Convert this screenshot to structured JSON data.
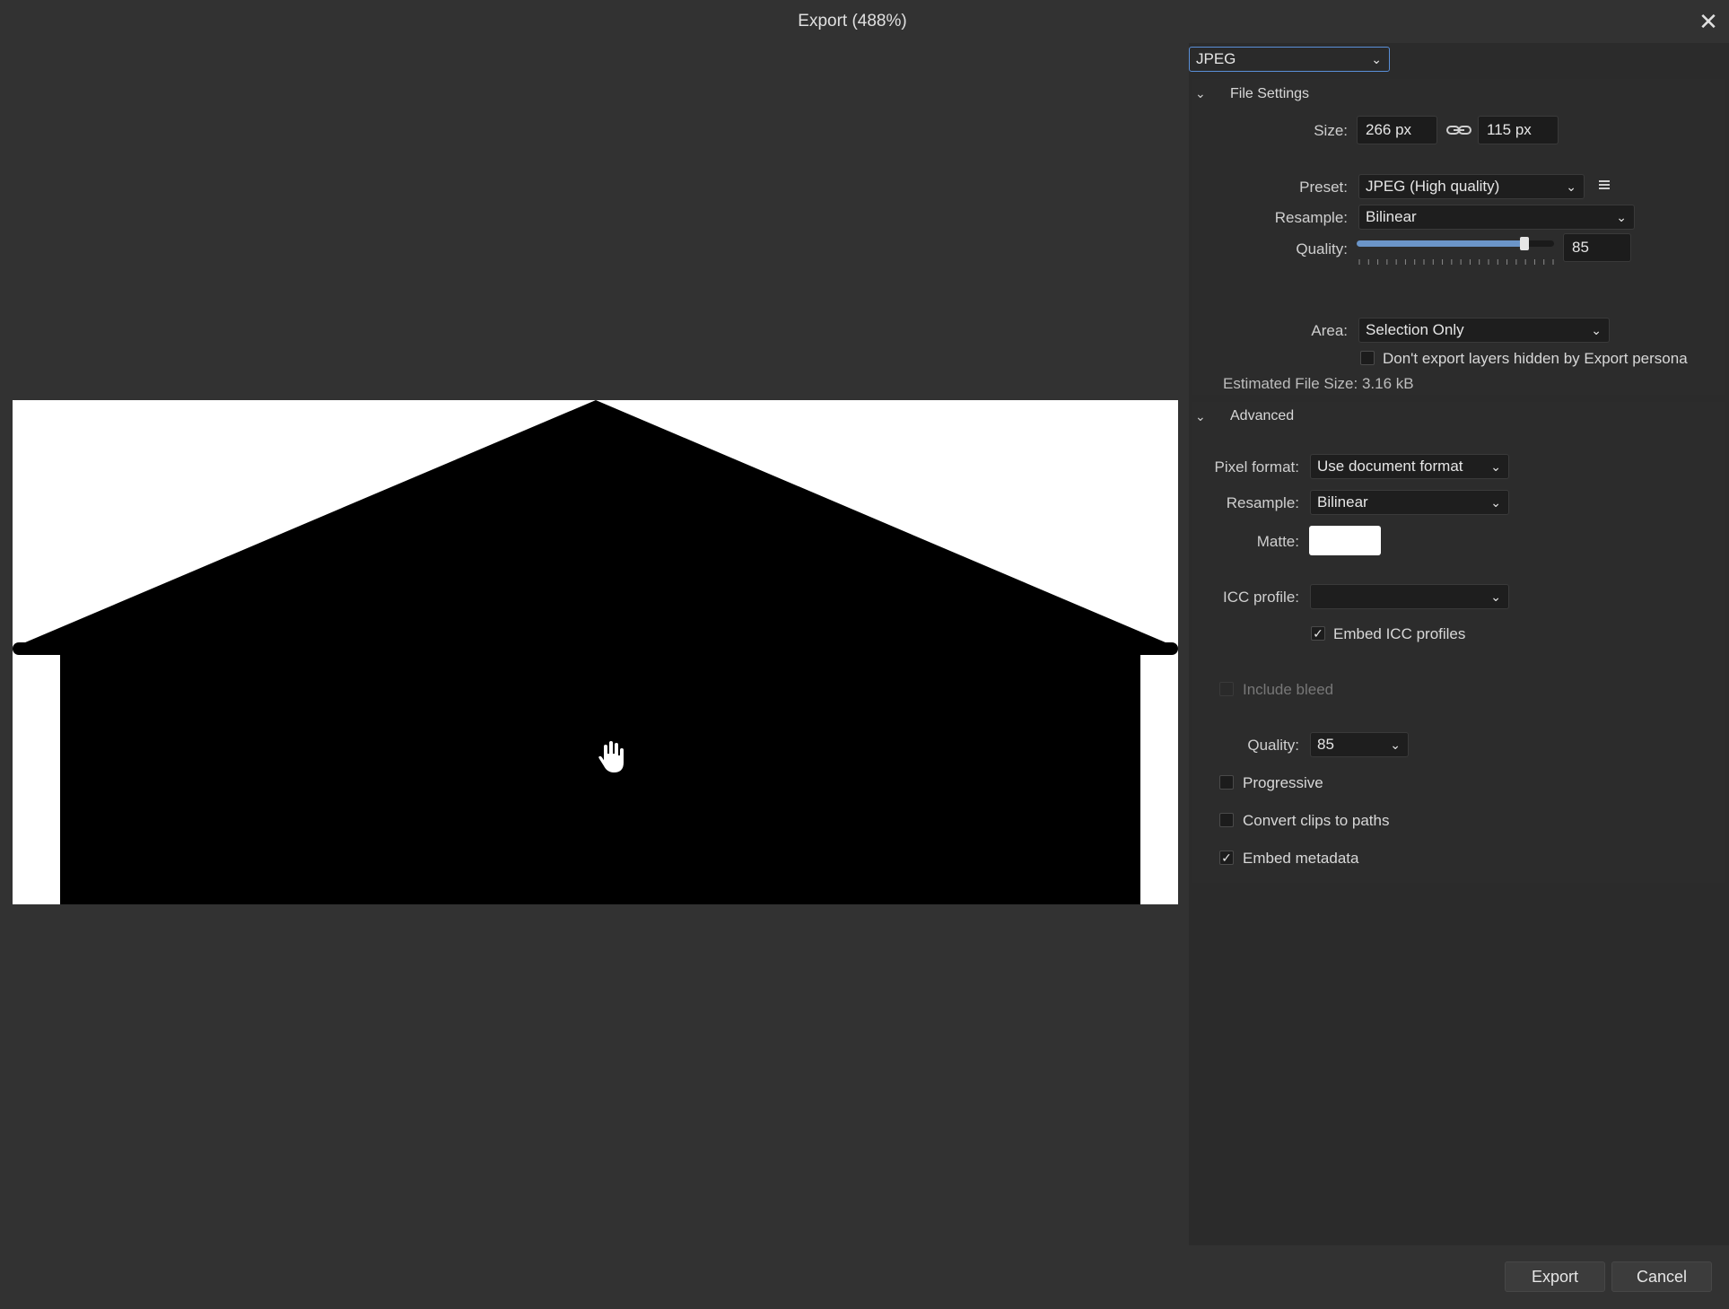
{
  "window": {
    "title": "Export (488%)",
    "close_glyph": "✕"
  },
  "format": {
    "selected": "JPEG"
  },
  "file_settings": {
    "header": "File Settings",
    "size_label": "Size:",
    "width": "266 px",
    "height": "115 px",
    "preset_label": "Preset:",
    "preset_value": "JPEG (High quality)",
    "resample_label": "Resample:",
    "resample_value": "Bilinear",
    "quality_label": "Quality:",
    "quality_value": "85",
    "quality_fraction": 0.85,
    "area_label": "Area:",
    "area_value": "Selection Only",
    "hidden_layers_label": "Don't export layers hidden by Export persona",
    "hidden_layers_checked": false,
    "estimated_size": "Estimated File Size: 3.16 kB"
  },
  "advanced": {
    "header": "Advanced",
    "pixel_format_label": "Pixel format:",
    "pixel_format_value": "Use document format",
    "resample_label": "Resample:",
    "resample_value": "Bilinear",
    "matte_label": "Matte:",
    "matte_color": "#ffffff",
    "icc_label": "ICC profile:",
    "icc_value": "",
    "embed_icc_label": "Embed ICC profiles",
    "embed_icc_checked": true,
    "include_bleed_label": "Include bleed",
    "include_bleed_checked": false,
    "quality_label": "Quality:",
    "quality_value": "85",
    "progressive_label": "Progressive",
    "progressive_checked": false,
    "convert_clips_label": "Convert clips to paths",
    "convert_clips_checked": false,
    "embed_metadata_label": "Embed metadata",
    "embed_metadata_checked": true
  },
  "buttons": {
    "export": "Export",
    "cancel": "Cancel"
  },
  "icons": {
    "chevron": "chevron-down-icon",
    "link": "link-icon",
    "menu": "hamburger-menu-icon",
    "cursor": "hand-cursor-icon",
    "check": "✓"
  },
  "colors": {
    "background": "#323232",
    "panel": "#2b2b2b",
    "accent": "#6b95c8"
  }
}
